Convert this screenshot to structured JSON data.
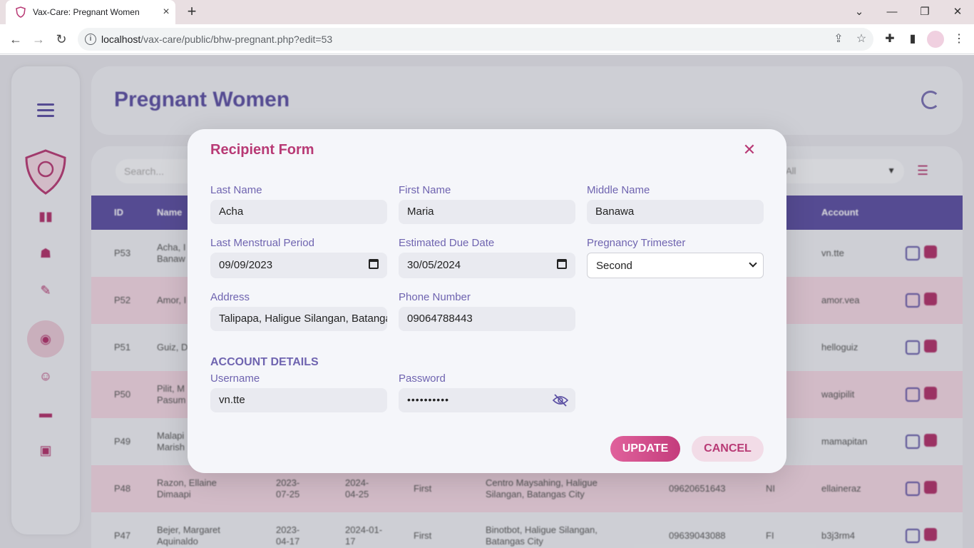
{
  "browser": {
    "tab_title": "Vax-Care: Pregnant Women",
    "tab_close_glyph": "×",
    "newtab_glyph": "+",
    "url_host": "localhost",
    "url_path": "/vax-care/public/bhw-pregnant.php?edit=53",
    "window_controls": [
      "⌄",
      "—",
      "❐",
      "✕"
    ]
  },
  "app": {
    "page_title": "Pregnant Women",
    "search_placeholder": "Search...",
    "filter_value": "All",
    "table_headers": [
      "ID",
      "Name",
      "Account"
    ],
    "rows": [
      {
        "id": "P53",
        "name": "Acha, I\nBanaw",
        "lmp": "",
        "due": "",
        "tri": "",
        "addr": "",
        "phone": "",
        "status": "",
        "account": "vn.tte"
      },
      {
        "id": "P52",
        "name": "Amor, I",
        "lmp": "",
        "due": "",
        "tri": "",
        "addr": "",
        "phone": "",
        "status": "",
        "account": "amor.vea"
      },
      {
        "id": "P51",
        "name": "Guiz, D",
        "lmp": "",
        "due": "",
        "tri": "",
        "addr": "",
        "phone": "",
        "status": "",
        "account": "helloguiz"
      },
      {
        "id": "P50",
        "name": "Pilit, M\nPasum",
        "lmp": "",
        "due": "",
        "tri": "",
        "addr": "",
        "phone": "",
        "status": "",
        "account": "wagipilit"
      },
      {
        "id": "P49",
        "name": "Malapi\nMarish",
        "lmp": "",
        "due": "",
        "tri": "",
        "addr": "",
        "phone": "",
        "status": "",
        "account": "mamapitan"
      },
      {
        "id": "P48",
        "name": "Razon, Ellaine\nDimaapi",
        "lmp": "2023-\n07-25",
        "due": "2024-\n04-25",
        "tri": "First",
        "addr": "Centro Maysahing, Haligue\nSilangan, Batangas City",
        "phone": "09620651643",
        "status": "NI",
        "account": "ellaineraz"
      },
      {
        "id": "P47",
        "name": "Bejer, Margaret\nAquinaldo",
        "lmp": "2023-\n04-17",
        "due": "2024-01-\n17",
        "tri": "First",
        "addr": "Binotbot, Haligue Silangan,\nBatangas City",
        "phone": "09639043088",
        "status": "FI",
        "account": "b3j3rm4"
      }
    ]
  },
  "modal": {
    "title": "Recipient Form",
    "close_glyph": "✕",
    "fields": {
      "last_name": {
        "label": "Last Name",
        "value": "Acha"
      },
      "first_name": {
        "label": "First Name",
        "value": "Maria"
      },
      "middle_name": {
        "label": "Middle Name",
        "value": "Banawa"
      },
      "lmp": {
        "label": "Last Menstrual Period",
        "value": "09/09/2023"
      },
      "due_date": {
        "label": "Estimated Due Date",
        "value": "30/05/2024"
      },
      "trimester": {
        "label": "Pregnancy Trimester",
        "value": "Second"
      },
      "address": {
        "label": "Address",
        "value": "Talipapa, Haligue Silangan, Batangas City"
      },
      "phone": {
        "label": "Phone Number",
        "value": "09064788443"
      }
    },
    "account_section": "ACCOUNT DETAILS",
    "username": {
      "label": "Username",
      "value": "vn.tte"
    },
    "password": {
      "label": "Password",
      "value": "••••••••••"
    },
    "update_label": "UPDATE",
    "cancel_label": "CANCEL"
  },
  "colors": {
    "accent_purple": "#5b4fa3",
    "accent_pink": "#b83a75",
    "row_alt": "#f3d7e3"
  }
}
